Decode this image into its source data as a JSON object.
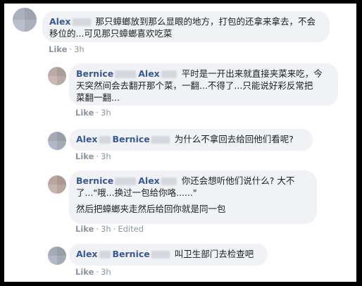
{
  "comments": [
    {
      "author": "Alex",
      "mention": "",
      "text_lines": [
        "那只蟑螂放到那么显眼的地方，打包的还拿来拿去，不会",
        "移位的...可见那只蟑螂喜欢吃菜"
      ],
      "actions": {
        "like": "Like",
        "time": "3h",
        "edited": ""
      }
    },
    {
      "author": "Bernice",
      "mention": "Alex",
      "text_lines": [
        "平时是一开出来就直接夹菜来吃，今",
        "天突然间会去翻开那个菜，一翻...不得了...只能说好彩反常把",
        "菜翻一翻..."
      ],
      "actions": {
        "like": "Like",
        "time": "3h",
        "edited": ""
      }
    },
    {
      "author": "Alex",
      "mention": "Bernice",
      "text_lines": [
        "为什么不拿回去给回他们看呢?"
      ],
      "actions": {
        "like": "Like",
        "time": "3h",
        "edited": ""
      }
    },
    {
      "author": "Bernice",
      "mention": "Alex",
      "text_lines": [
        "你还会想听他们说什么? 大不",
        "了...\"哦...换过一包给你咯......\"",
        "",
        "然后把蟑螂夹走然后给回你就是同一包"
      ],
      "actions": {
        "like": "Like",
        "time": "3h",
        "edited": "Edited"
      }
    },
    {
      "author": "Alex",
      "mention": "Bernice",
      "text_lines": [
        "叫卫生部门去检查吧"
      ],
      "actions": {
        "like": "Like",
        "time": "3h",
        "edited": ""
      }
    }
  ],
  "colors": {
    "name": "#385898",
    "bubble": "#f0f2f5",
    "meta": "#8d949e",
    "frame": "#000000"
  },
  "icons": {
    "avatar": "pixelated-avatar"
  }
}
